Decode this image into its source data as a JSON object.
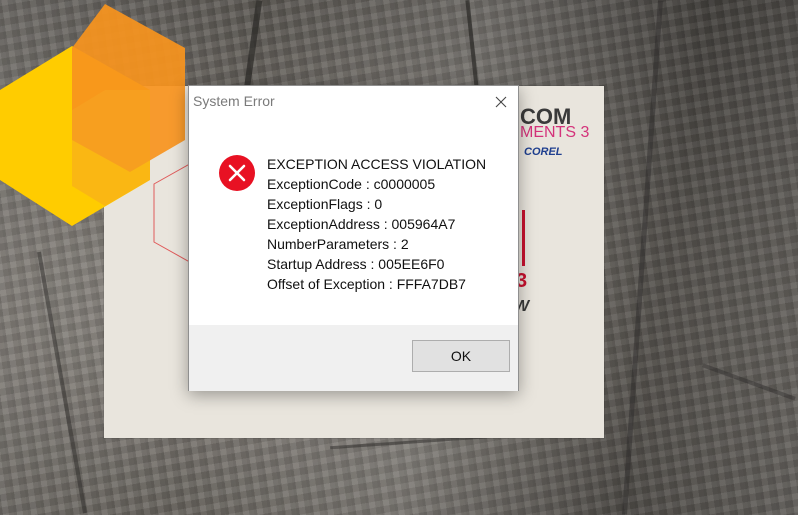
{
  "dialog": {
    "title": "System Error",
    "close_icon": "close-icon",
    "error_icon": "error-x-icon",
    "message_lines": [
      "EXCEPTION ACCESS VIOLATION",
      "ExceptionCode : c0000005",
      "ExceptionFlags : 0",
      "ExceptionAddress : 005964A7",
      "NumberParameters : 2",
      "Startup Address : 005EE6F0",
      "Offset of Exception : FFFA7DB7"
    ],
    "ok_label": "OK"
  },
  "splash": {
    "brand_line_1": "COM",
    "brand_line_2": "MENTS 3",
    "brand_line_3": "COREL",
    "number": "3",
    "suffix": "W"
  },
  "colors": {
    "error_red": "#e81123",
    "logo_yellow": "#ffcc00",
    "logo_orange": "#f7941d",
    "splash_accent": "#c8102e"
  }
}
